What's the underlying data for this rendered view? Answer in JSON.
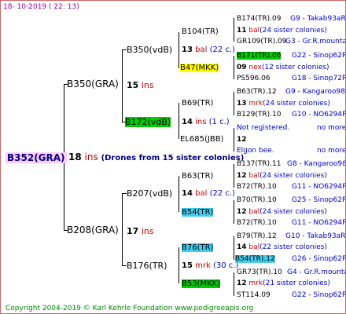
{
  "date": "18- 10-2019 ( 22: 13)",
  "footer": "Copyright 2004-2019 © Karl Kehrle Foundation   www.pedigreeapis.org",
  "root": {
    "name": "B352(GRA)",
    "num": "18",
    "unit": "ins",
    "drones": "(Drones from 15 sister colonies)"
  },
  "gen2": [
    {
      "name": "B350(GRA)",
      "num": "15",
      "unit": "ins"
    },
    {
      "name": "B208(GRA)",
      "num": "17",
      "unit": "ins"
    }
  ],
  "gen3": [
    {
      "name": "B350(vdB)",
      "num": "13",
      "unit": "bal",
      "extra": "(22 c.)"
    },
    {
      "name": "B172(vdB)",
      "num": "14",
      "unit": "ins",
      "extra": "(1 c.)"
    },
    {
      "name": "B207(vdB)",
      "num": "14",
      "unit": "bal",
      "extra": "(22 c.)"
    },
    {
      "name": "B176(TR)",
      "num": "15",
      "unit": "mrk",
      "extra": "(30 c.)"
    }
  ],
  "gen4": [
    {
      "name": "B104(TR)",
      "num": "11",
      "unit": "bal",
      "extra": "(24 sister colonies)"
    },
    {
      "name": "B47(MKK)",
      "num": "09",
      "unit": "nex",
      "extra": "(12 sister colonies)"
    },
    {
      "name": "B69(TR)",
      "num": "13",
      "unit": "mrk",
      "extra": "(24 sister colonies)"
    },
    {
      "name": "EL685(JBB)",
      "num": "12",
      "unit": "",
      "extra": ""
    },
    {
      "name": "B63(TR)",
      "num": "12",
      "unit": "bal",
      "extra": "(24 sister colonies)"
    },
    {
      "name": "B54(TR)",
      "num": "12",
      "unit": "bal",
      "extra": "(24 sister colonies)"
    },
    {
      "name": "B76(TR)",
      "num": "14",
      "unit": "bal",
      "extra": "(22 sister colonies)"
    },
    {
      "name": "B53(MKK)",
      "num": "12",
      "unit": "mrk",
      "extra": "(21 sister colonies)"
    }
  ],
  "gen5": [
    {
      "name": "B174(TR).09",
      "code": "G9 - Takab93aR"
    },
    {
      "name": "GR109(TR).09",
      "code": "G3 - Gr.R.mounta"
    },
    {
      "name": "B171(TR).06",
      "code": "G22 - Sinop62R"
    },
    {
      "name": "PS596.06",
      "code": "G18 - Sinop72R"
    },
    {
      "name": "B63(TR).12",
      "code": "G9 - Kangaroo98R"
    },
    {
      "name": "B129(TR).10",
      "code": "G10 - NO6294R"
    },
    {
      "name": "Not registered.",
      "code": "no more"
    },
    {
      "name": "Elgon bee.",
      "code": "no more"
    },
    {
      "name": "B137(TR).11",
      "code": "G8 - Kangaroo98R"
    },
    {
      "name": "B72(TR).10",
      "code": "G11 - NO6294R"
    },
    {
      "name": "B70(TR).10",
      "code": "G25 - Sinop62R"
    },
    {
      "name": "B72(TR).10",
      "code": "G11 - NO6294R"
    },
    {
      "name": "B79(TR).12",
      "code": "G10 - Takab93aR"
    },
    {
      "name": "B54(TR).12",
      "code": "G26 - Sinop62R"
    },
    {
      "name": "GR73(TR).10",
      "code": "G4 - Gr.R.mounta"
    },
    {
      "name": "ST114.09",
      "code": "G22 - Sinop62R"
    }
  ]
}
